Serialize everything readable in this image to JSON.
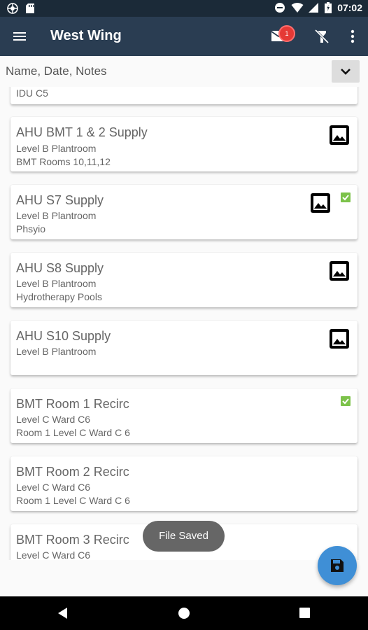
{
  "status_bar": {
    "time": "07:02"
  },
  "app_bar": {
    "title": "West Wing",
    "notification_count": "1"
  },
  "search": {
    "placeholder": "Name, Date, Notes"
  },
  "items": [
    {
      "title": "",
      "line1": "IDU C5",
      "line2": ""
    },
    {
      "title": "AHU BMT 1 & 2 Supply",
      "line1": "Level B Plantroom",
      "line2": "BMT Rooms 10,11,12",
      "has_image": true,
      "checked": false
    },
    {
      "title": "AHU S7 Supply",
      "line1": "Level B Plantroom",
      "line2": "Phsyio",
      "has_image": true,
      "checked": true
    },
    {
      "title": "AHU S8 Supply",
      "line1": "Level B Plantroom",
      "line2": "Hydrotherapy Pools",
      "has_image": true,
      "checked": false
    },
    {
      "title": "AHU S10 Supply",
      "line1": "Level B Plantroom",
      "line2": "",
      "has_image": true,
      "checked": false
    },
    {
      "title": "BMT Room 1 Recirc",
      "line1": "Level C Ward C6",
      "line2": "Room 1 Level C Ward C 6",
      "has_image": false,
      "checked": true
    },
    {
      "title": "BMT Room 2 Recirc",
      "line1": "Level C Ward C6",
      "line2": "Room 1 Level C Ward C 6",
      "has_image": false,
      "checked": false
    },
    {
      "title": "BMT Room 3 Recirc",
      "line1": "Level C Ward C6",
      "line2": "",
      "has_image": false,
      "checked": false
    }
  ],
  "toast": {
    "text": "File Saved"
  },
  "colors": {
    "app_bar": "#2a3d52",
    "status_bar": "#1b2a38",
    "fab": "#3f8fd6",
    "badge": "#e53935",
    "check": "#7cc24a"
  },
  "icons": [
    "menu-icon",
    "mail-icon",
    "flashlight-off-icon",
    "more-vert-icon",
    "chevron-down-icon",
    "image-icon",
    "checkbox-checked-icon",
    "save-icon",
    "back-icon",
    "home-icon",
    "recents-icon"
  ]
}
